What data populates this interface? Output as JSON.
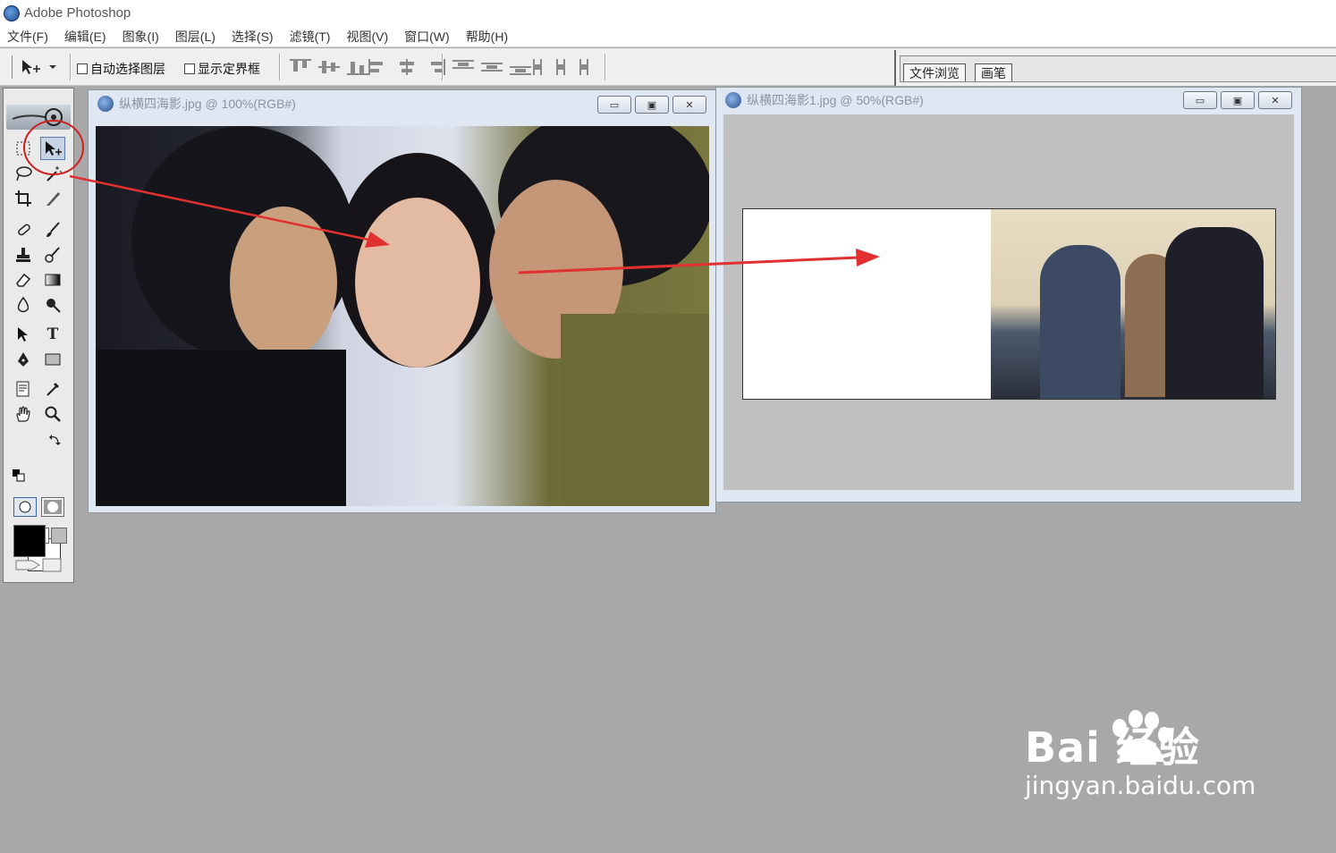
{
  "window": {
    "title": "Adobe Photoshop"
  },
  "menu": [
    "文件(F)",
    "编辑(E)",
    "图象(I)",
    "图层(L)",
    "选择(S)",
    "滤镜(T)",
    "视图(V)",
    "窗口(W)",
    "帮助(H)"
  ],
  "options": {
    "auto_select_layer": "自动选择图层",
    "show_bounding_box": "显示定界框"
  },
  "palette_well": {
    "tabs": [
      "文件浏览",
      "画笔"
    ]
  },
  "documents": [
    {
      "title": "纵横四海影.jpg @ 100%(RGB#)"
    },
    {
      "title": "纵横四海影1.jpg @ 50%(RGB#)"
    }
  ],
  "window_buttons": {
    "minimize": "▭",
    "restore": "▣",
    "close": "✕"
  },
  "toolbox": {
    "type_tool_glyph": "T"
  },
  "watermark": {
    "brand": "Bai 经验",
    "url": "jingyan.baidu.com"
  },
  "colors": {
    "annotation_red": "#e03030",
    "highlight_circle": "#d02020"
  }
}
